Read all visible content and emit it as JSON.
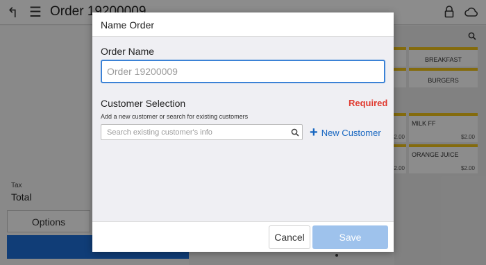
{
  "background": {
    "header": {
      "title": "Order 19200009"
    },
    "summary": {
      "tax_label": "Tax",
      "total_label": "Total",
      "options_label": "Options"
    },
    "categories": [
      {
        "label": "BREAKFAST"
      },
      {
        "label": "BURGERS"
      }
    ],
    "menu_items": [
      {
        "label": "MILK FF",
        "price": "$2.00"
      },
      {
        "label": "ORANGE JUICE",
        "price": "$2.00"
      }
    ],
    "partial_prices": [
      "$2.00",
      "$2.00"
    ]
  },
  "modal": {
    "title": "Name Order",
    "order_name": {
      "label": "Order Name",
      "value": "",
      "placeholder": "Order 19200009"
    },
    "customer": {
      "label": "Customer Selection",
      "required_label": "Required",
      "hint": "Add a new customer or search for existing customers",
      "search_placeholder": "Search existing customer's info",
      "new_customer_label": "New Customer"
    },
    "footer": {
      "cancel_label": "Cancel",
      "save_label": "Save"
    }
  },
  "colors": {
    "accent": "#1565c0",
    "input_focus": "#3b82d6",
    "required": "#e03a2f",
    "save_disabled": "#9ec2ec",
    "category_stripe": "#f0c419"
  }
}
